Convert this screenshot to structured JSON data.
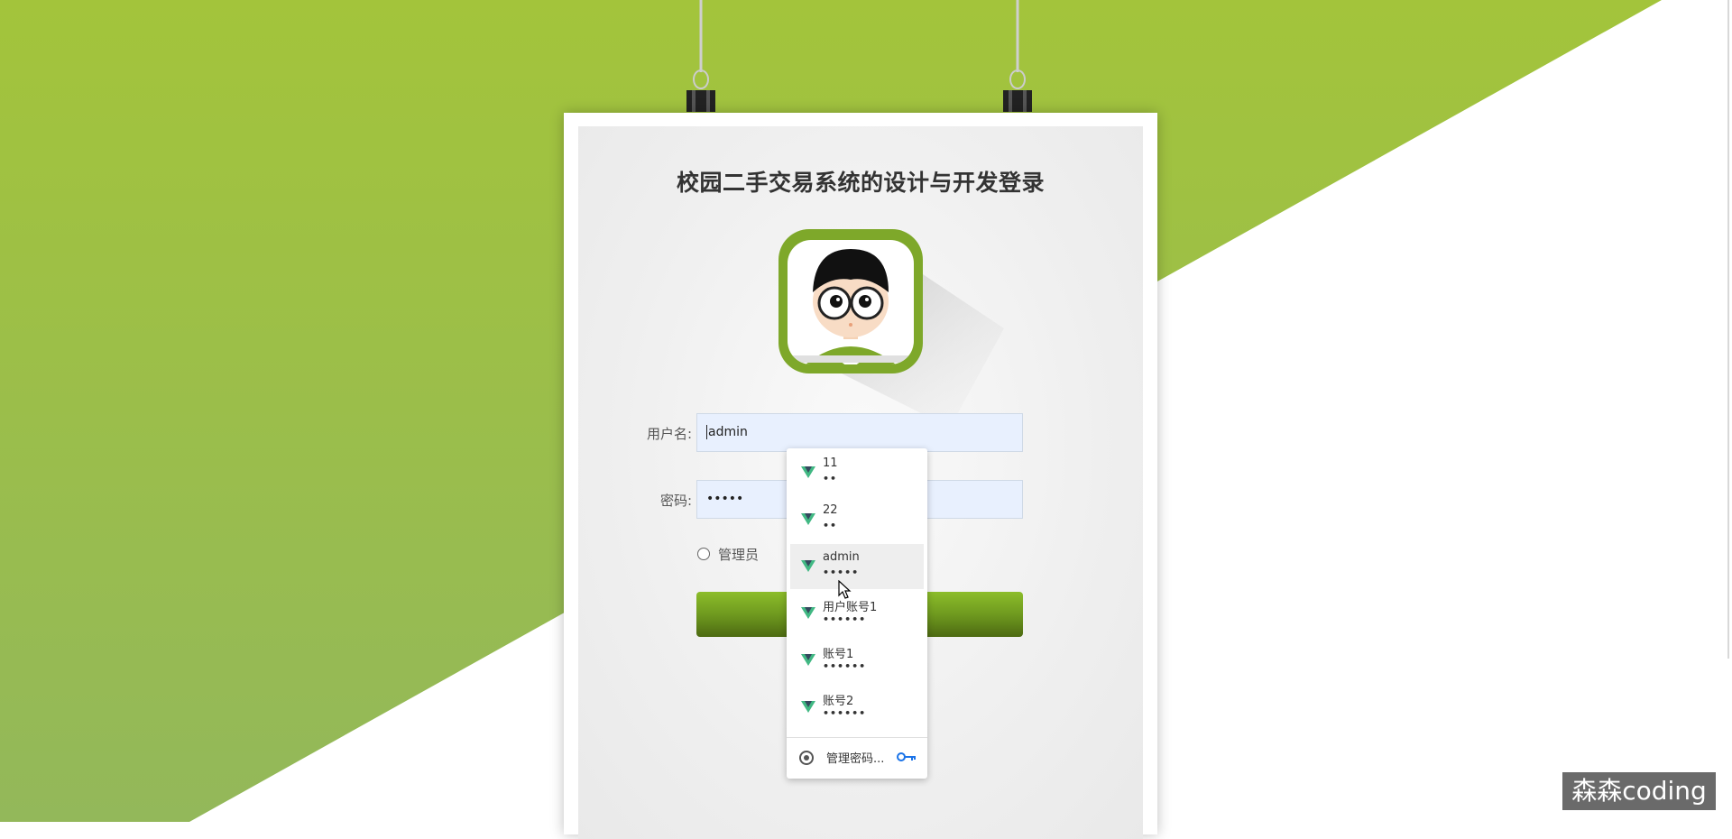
{
  "login": {
    "title": "校园二手交易系统的设计与开发登录",
    "username_label": "用户名:",
    "username_value": "admin",
    "password_label": "密码:",
    "password_value": "•••••",
    "role_option": "管理员"
  },
  "autofill": {
    "items": [
      {
        "user": "11",
        "pass": "••",
        "icon": "vue-logo-icon"
      },
      {
        "user": "22",
        "pass": "••",
        "icon": "vue-logo-icon"
      },
      {
        "user": "admin",
        "pass": "•••••",
        "icon": "vue-logo-icon",
        "highlighted": true
      },
      {
        "user": "用户账号1",
        "pass": "••••••",
        "icon": "vue-logo-icon"
      },
      {
        "user": "账号1",
        "pass": "••••••",
        "icon": "vue-logo-icon"
      },
      {
        "user": "账号2",
        "pass": "••••••",
        "icon": "vue-logo-icon"
      }
    ],
    "manage_label": "管理密码..."
  },
  "watermark": "森森coding",
  "colors": {
    "green_bg": "#9cc03e",
    "button_green": "#7aa624",
    "input_fill": "#e8f0fe"
  }
}
